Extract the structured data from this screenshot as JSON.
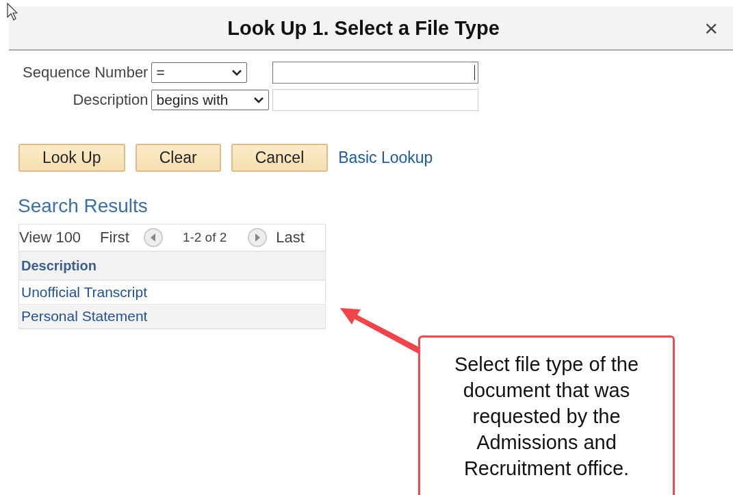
{
  "dialog": {
    "title": "Look Up 1. Select a File Type",
    "close": "×"
  },
  "filters": [
    {
      "label": "Sequence Number",
      "operator": "=",
      "value_focused": true
    },
    {
      "label": "Description",
      "operator": "begins with",
      "value_focused": false
    }
  ],
  "actions": [
    {
      "kind": "button",
      "label": "Look Up"
    },
    {
      "kind": "button",
      "label": "Clear"
    },
    {
      "kind": "button",
      "label": "Cancel"
    },
    {
      "kind": "link",
      "label": "Basic Lookup"
    }
  ],
  "results": {
    "title": "Search Results",
    "view": "View 100",
    "first": "First",
    "range": "1-2 of 2",
    "last": "Last",
    "columns": [
      "Description"
    ],
    "rows": [
      "Unofficial Transcript",
      "Personal Statement"
    ]
  },
  "callout": {
    "text": "Select file type of the document that was requested by the Admissions and Recruitment office."
  }
}
